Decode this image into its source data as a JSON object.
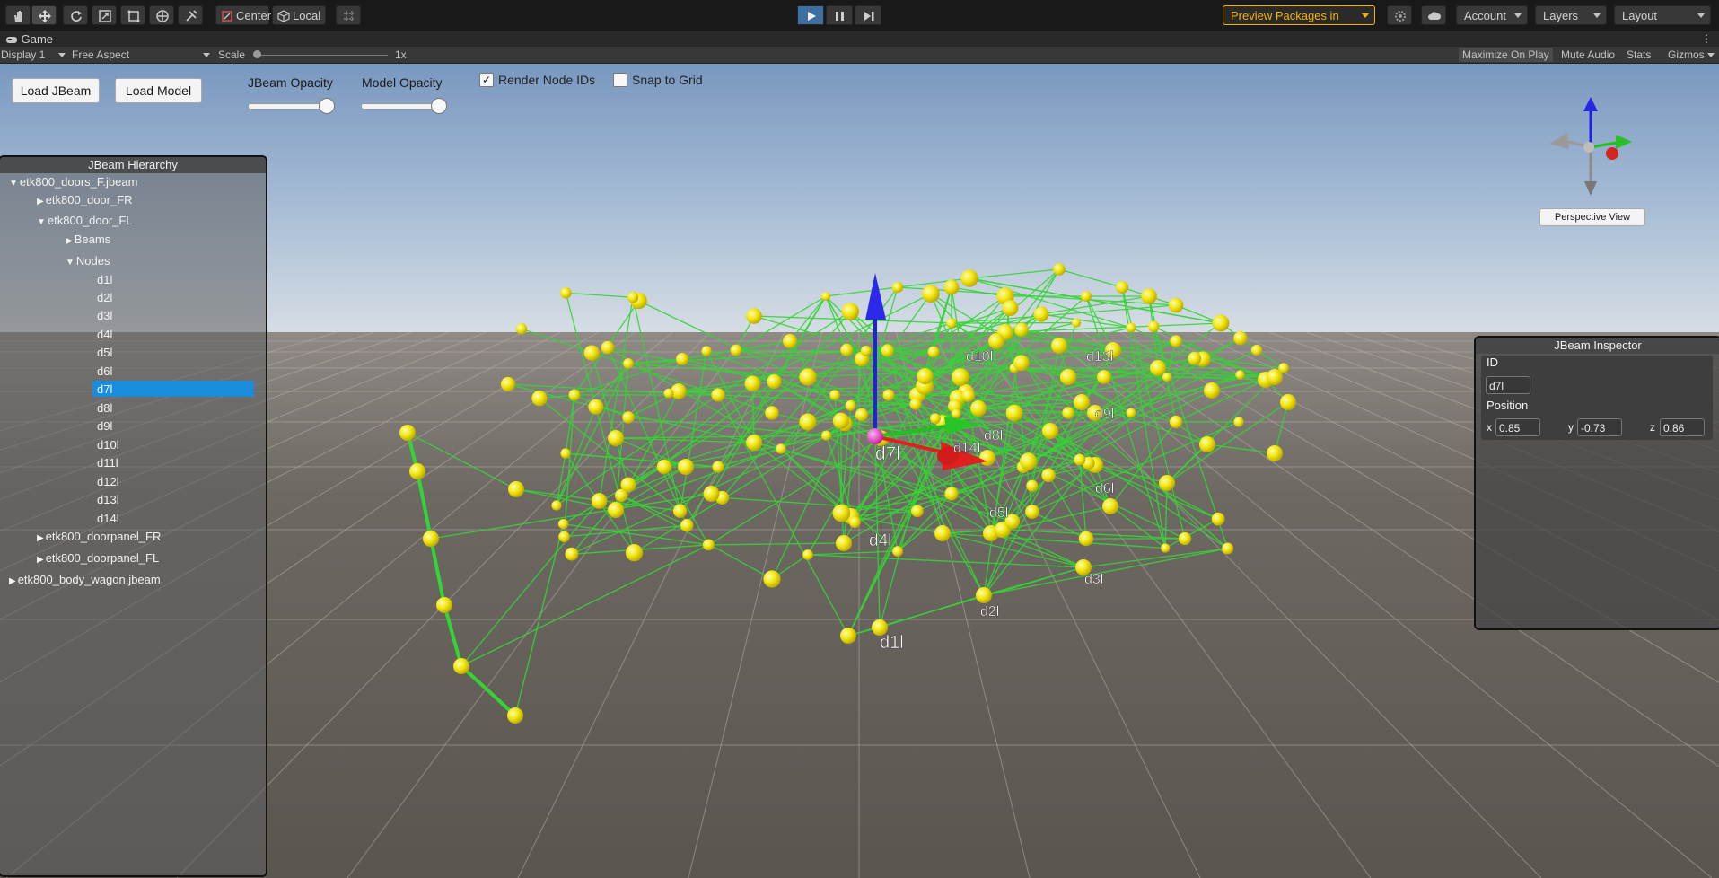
{
  "toolbar": {
    "tools": [
      "hand-tool",
      "move-tool",
      "rotate-tool",
      "scale-tool",
      "rect-tool",
      "transform-tool",
      "custom-tool"
    ],
    "pivot_mode": "Center",
    "pivot_rotation": "Local",
    "packages_label": "Preview Packages in Use",
    "account_label": "Account",
    "layers_label": "Layers",
    "layout_label": "Layout"
  },
  "game_tab": {
    "title": "Game",
    "display": "Display 1",
    "aspect": "Free Aspect",
    "scale_label": "Scale",
    "scale_value": "1x",
    "maximize_on_play": "Maximize On Play",
    "mute_audio": "Mute Audio",
    "stats": "Stats",
    "gizmos": "Gizmos"
  },
  "controls": {
    "load_jbeam": "Load JBeam",
    "load_model": "Load Model",
    "jbeam_opacity_label": "JBeam Opacity",
    "jbeam_opacity_value": 1.0,
    "model_opacity_label": "Model Opacity",
    "model_opacity_value": 1.0,
    "render_node_ids_label": "Render Node IDs",
    "render_node_ids_checked": true,
    "snap_to_grid_label": "Snap to Grid",
    "snap_to_grid_checked": false,
    "perspective_view": "Perspective View"
  },
  "hierarchy": {
    "title": "JBeam Hierarchy",
    "items": [
      {
        "label": "etk800_doors_F.jbeam",
        "expanded": true
      },
      {
        "label": "etk800_door_FR",
        "expanded": false
      },
      {
        "label": "etk800_door_FL",
        "expanded": true
      },
      {
        "label": "Beams",
        "expanded": false
      },
      {
        "label": "Nodes",
        "expanded": true
      },
      {
        "label": "d1l"
      },
      {
        "label": "d2l"
      },
      {
        "label": "d3l"
      },
      {
        "label": "d4l"
      },
      {
        "label": "d5l"
      },
      {
        "label": "d6l"
      },
      {
        "label": "d7l",
        "selected": true
      },
      {
        "label": "d8l"
      },
      {
        "label": "d9l"
      },
      {
        "label": "d10l"
      },
      {
        "label": "d11l"
      },
      {
        "label": "d12l"
      },
      {
        "label": "d13l"
      },
      {
        "label": "d14l"
      },
      {
        "label": "etk800_doorpanel_FR",
        "expanded": false
      },
      {
        "label": "etk800_doorpanel_FL",
        "expanded": false
      },
      {
        "label": "etk800_body_wagon.jbeam",
        "expanded": false
      }
    ]
  },
  "inspector": {
    "title": "JBeam Inspector",
    "id_label": "ID",
    "id_value": "d7l",
    "position_label": "Position",
    "x_label": "x",
    "x_value": "0.85",
    "y_label": "y",
    "y_value": "-0.73",
    "z_label": "z",
    "z_value": "0.86"
  },
  "scene": {
    "node_labels": [
      "d1l",
      "d2l",
      "d3l",
      "d4l",
      "d5l",
      "d6l",
      "d7l",
      "d8l",
      "d9l",
      "d10l",
      "d13l",
      "d14l"
    ],
    "colors": {
      "node": "#f2e60f",
      "beam": "#35d435",
      "selected_node": "#e23bd8",
      "axis_x": "#e02020",
      "axis_y": "#2020e0",
      "axis_z": "#20c020",
      "sky_top": "#7a9cc6",
      "ground": "#5f5a55",
      "panel_selection": "#1b8bdc",
      "packages_accent": "#f5b400"
    }
  }
}
